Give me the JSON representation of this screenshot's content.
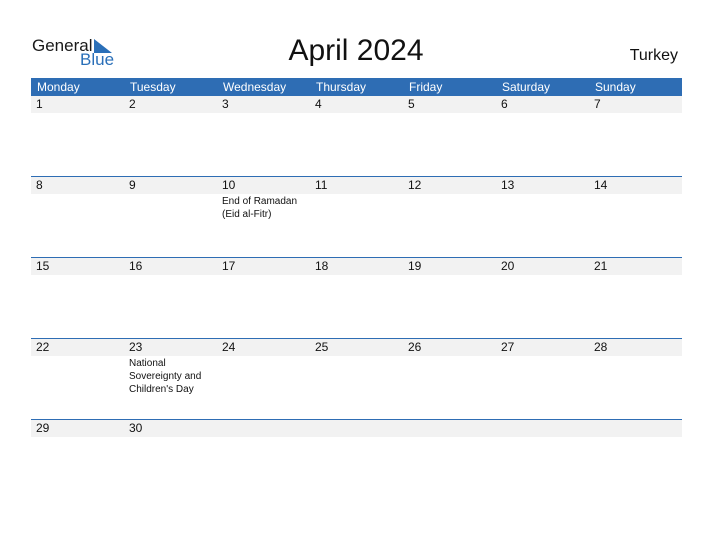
{
  "logo": {
    "general": "General",
    "blue": "Blue"
  },
  "title": "April 2024",
  "country": "Turkey",
  "weekdays": [
    "Monday",
    "Tuesday",
    "Wednesday",
    "Thursday",
    "Friday",
    "Saturday",
    "Sunday"
  ],
  "weeks": [
    [
      {
        "d": "1"
      },
      {
        "d": "2"
      },
      {
        "d": "3"
      },
      {
        "d": "4"
      },
      {
        "d": "5"
      },
      {
        "d": "6"
      },
      {
        "d": "7"
      }
    ],
    [
      {
        "d": "8"
      },
      {
        "d": "9"
      },
      {
        "d": "10",
        "h": "End of Ramadan (Eid al-Fitr)"
      },
      {
        "d": "11"
      },
      {
        "d": "12"
      },
      {
        "d": "13"
      },
      {
        "d": "14"
      }
    ],
    [
      {
        "d": "15"
      },
      {
        "d": "16"
      },
      {
        "d": "17"
      },
      {
        "d": "18"
      },
      {
        "d": "19"
      },
      {
        "d": "20"
      },
      {
        "d": "21"
      }
    ],
    [
      {
        "d": "22"
      },
      {
        "d": "23",
        "h": "National Sovereignty and Children's Day"
      },
      {
        "d": "24"
      },
      {
        "d": "25"
      },
      {
        "d": "26"
      },
      {
        "d": "27"
      },
      {
        "d": "28"
      }
    ],
    [
      {
        "d": "29"
      },
      {
        "d": "30"
      }
    ]
  ]
}
